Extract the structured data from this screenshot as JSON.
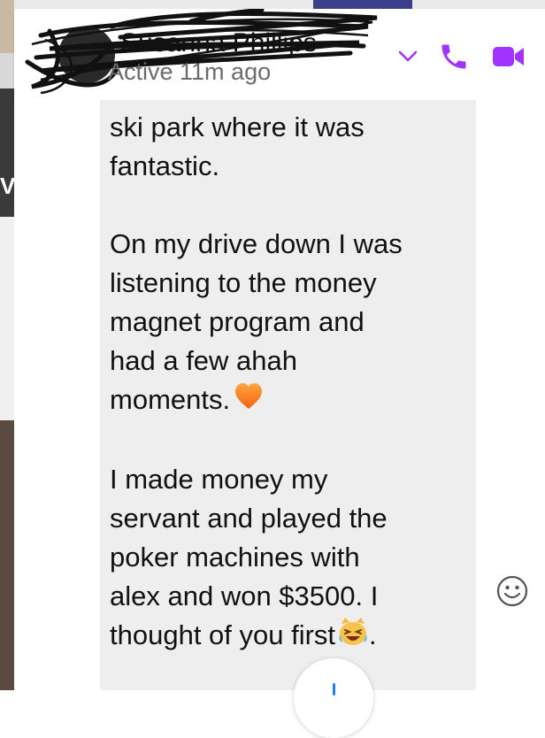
{
  "header": {
    "contact_name": "Susanna Phillips",
    "status": "Active 11m ago",
    "chevron_icon": "chevron-down-icon",
    "phone_icon": "phone-icon",
    "video_icon": "video-camera-icon"
  },
  "message": {
    "lines_para1": [
      "ski park where it was",
      "fantastic."
    ],
    "lines_para2": [
      "On my drive down I was",
      "listening to the money",
      "magnet program and",
      "had a few ahah",
      "moments."
    ],
    "lines_para3": [
      "I made money my",
      "servant and played the",
      "poker machines with",
      "alex and won $3500. I",
      "thought of you first"
    ],
    "end_punct": "."
  },
  "colors": {
    "accent": "#a033ff",
    "bubble": "#eeeeee",
    "status_text": "#6b6b6b"
  },
  "icons": {
    "heart": "orange-heart-icon",
    "cat": "crying-laughing-cat-icon",
    "react": "smiley-react-icon",
    "scroll": "scroll-down-button"
  }
}
